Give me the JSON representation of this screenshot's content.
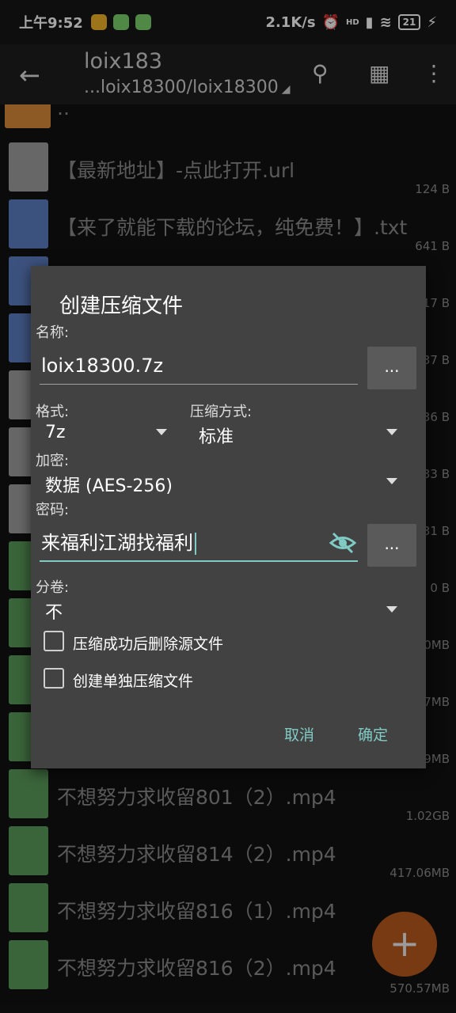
{
  "status_bar": {
    "time": "上午9:52",
    "speed": "2.1K/s",
    "signal_label": "HD",
    "battery": "21"
  },
  "app_bar": {
    "title": "loix183",
    "path": "...loix18300/loix18300"
  },
  "files": [
    {
      "name": "..",
      "size": "",
      "icon": "folder-up-icon"
    },
    {
      "name": "【最新地址】-点此打开.url",
      "size": "124 B",
      "icon": "document-icon"
    },
    {
      "name": "【来了就能下载的论坛，纯免费！】.txt",
      "size": "641 B",
      "icon": "text-file-icon"
    },
    {
      "name": "",
      "size": "17 B",
      "icon": "text-file-icon"
    },
    {
      "name": "",
      "size": "37 B",
      "icon": "text-file-icon"
    },
    {
      "name": "",
      "size": "36 B",
      "icon": "document-icon"
    },
    {
      "name": "",
      "size": "33 B",
      "icon": "document-icon"
    },
    {
      "name": "",
      "size": "31 B",
      "icon": "document-icon"
    },
    {
      "name": "",
      "size": "0 B",
      "icon": "image-file-icon"
    },
    {
      "name": "",
      "size": "0MB",
      "icon": "video-file-icon"
    },
    {
      "name": "",
      "size": "7MB",
      "icon": "video-file-icon"
    },
    {
      "name": "",
      "size": "9MB",
      "icon": "video-file-icon"
    },
    {
      "name": "不想努力求收留801（2）.mp4",
      "size": "1.02GB",
      "icon": "video-file-icon"
    },
    {
      "name": "不想努力求收留814（2）.mp4",
      "size": "417.06MB",
      "icon": "video-file-icon"
    },
    {
      "name": "不想努力求收留816（1）.mp4",
      "size": "",
      "icon": "video-file-icon"
    },
    {
      "name": "不想努力求收留816（2）.mp4",
      "size": "570.57MB",
      "icon": "video-file-icon"
    }
  ],
  "fab": {
    "label": "+"
  },
  "dialog": {
    "title": "创建压缩文件",
    "name_label": "名称:",
    "name_value": "loix18300.7z",
    "browse_label": "...",
    "format_label": "格式:",
    "format_value": "7z",
    "method_label": "压缩方式:",
    "method_value": "标准",
    "encryption_label": "加密:",
    "encryption_value": "数据 (AES-256)",
    "password_label": "密码:",
    "password_value": "来福利江湖找福利",
    "split_label": "分卷:",
    "split_value": "不",
    "delete_source_label": "压缩成功后删除源文件",
    "separate_archives_label": "创建单独压缩文件",
    "cancel_label": "取消",
    "ok_label": "确定"
  },
  "colors": {
    "accent": "#80cbc4",
    "dialog_bg": "#424242",
    "fab": "#b85a1c"
  }
}
